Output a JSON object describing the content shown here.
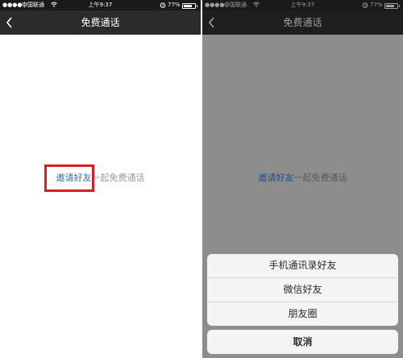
{
  "status_bar": {
    "signal": "●●●●○",
    "carrier": "中国联通",
    "wifi_icon": "wifi-icon",
    "time": "上午9:37",
    "alarm_icon": "alarm-icon",
    "battery": "77%",
    "battery_level": 0.77
  },
  "navbar": {
    "back_icon": "chevron-left-icon",
    "title": "免费通话"
  },
  "invite": {
    "link": "邀请好友",
    "text": "一起免费通话"
  },
  "action_sheet": {
    "options": [
      "手机通讯录好友",
      "微信好友",
      "朋友圈"
    ],
    "cancel": "取消"
  },
  "colors": {
    "link": "#2d6fb3",
    "highlight": "#d42020",
    "overlay": "#8d8d8d"
  }
}
